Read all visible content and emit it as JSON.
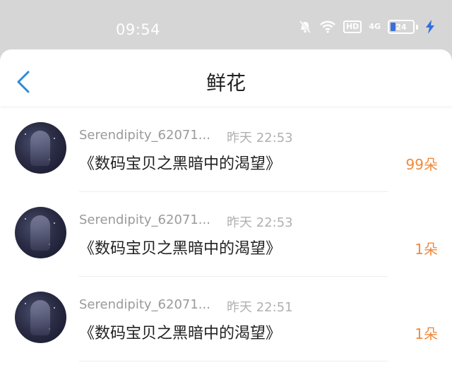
{
  "status_bar": {
    "time": "09:54",
    "hd_label": "HD",
    "network_label": "4G",
    "battery_level": "24",
    "battery_fill_percent": 24
  },
  "header": {
    "title": "鲜花"
  },
  "items": [
    {
      "username": "Serendipity_62071...",
      "time": "昨天 22:53",
      "book": "《数码宝贝之黑暗中的渴望》",
      "count": "99朵"
    },
    {
      "username": "Serendipity_62071...",
      "time": "昨天 22:53",
      "book": "《数码宝贝之黑暗中的渴望》",
      "count": "1朵"
    },
    {
      "username": "Serendipity_62071...",
      "time": "昨天 22:51",
      "book": "《数码宝贝之黑暗中的渴望》",
      "count": "1朵"
    }
  ],
  "icons": {
    "back": "chevron-left-icon",
    "mute": "bell-off-icon",
    "wifi": "wifi-icon",
    "charging": "lightning-icon"
  },
  "colors": {
    "accent": "#2e8bd8",
    "count": "#f08a3c"
  }
}
